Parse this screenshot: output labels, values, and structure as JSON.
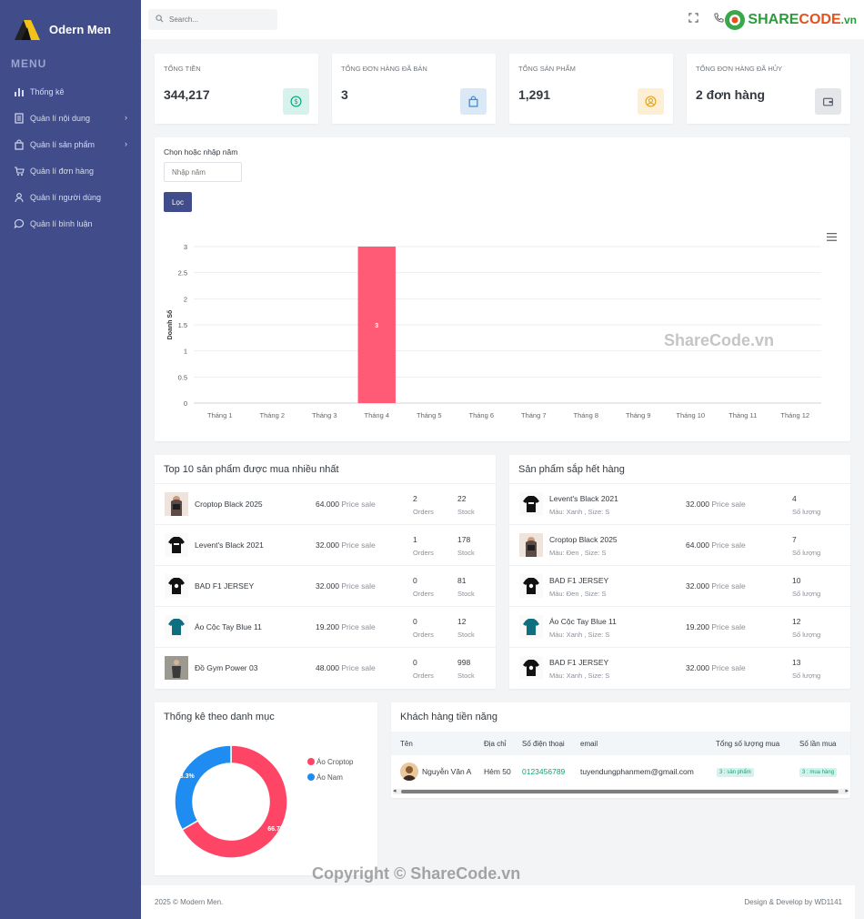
{
  "sidebar": {
    "brand": "Odern Men",
    "menu_title": "MENU",
    "items": [
      {
        "label": "Thống kê",
        "icon": "bar-chart-icon",
        "has_children": false
      },
      {
        "label": "Quản lí nội dung",
        "icon": "document-icon",
        "has_children": true
      },
      {
        "label": "Quản lí sản phẩm",
        "icon": "shopping-bag-icon",
        "has_children": true
      },
      {
        "label": "Quản lí đơn hàng",
        "icon": "cart-icon",
        "has_children": false
      },
      {
        "label": "Quản lí người dùng",
        "icon": "user-icon",
        "has_children": false
      },
      {
        "label": "Quản lí bình luận",
        "icon": "comment-icon",
        "has_children": false
      }
    ]
  },
  "topbar": {
    "search_placeholder": "Search...",
    "brand_part1": "SHARE",
    "brand_part2": "CODE",
    "brand_part3": ".vn"
  },
  "stats": [
    {
      "label": "TỔNG TIỀN",
      "value": "344,217",
      "icon": "dollar-icon",
      "bg": "#d5f3ec",
      "fg": "#0ca678"
    },
    {
      "label": "TỔNG ĐƠN HÀNG ĐÃ BÁN",
      "value": "3",
      "icon": "shopping-bag-icon",
      "bg": "#dbe9f7",
      "fg": "#3b82c4"
    },
    {
      "label": "TỔNG SẢN PHẨM",
      "value": "1,291",
      "icon": "user-circle-icon",
      "bg": "#fcefd4",
      "fg": "#e0a528"
    },
    {
      "label": "TỔNG ĐƠN HÀNG ĐÃ HỦY",
      "value": "2 đơn hàng",
      "icon": "wallet-icon",
      "bg": "#e4e6ea",
      "fg": "#5a6270"
    }
  ],
  "filter": {
    "label": "Chọn hoặc nhập năm",
    "placeholder": "Nhập năm",
    "button": "Lọc"
  },
  "chart_data": {
    "type": "bar",
    "categories": [
      "Tháng 1",
      "Tháng 2",
      "Tháng 3",
      "Tháng 4",
      "Tháng 5",
      "Tháng 6",
      "Tháng 7",
      "Tháng 8",
      "Tháng 9",
      "Tháng 10",
      "Tháng 11",
      "Tháng 12"
    ],
    "values": [
      0,
      0,
      0,
      3,
      0,
      0,
      0,
      0,
      0,
      0,
      0,
      0
    ],
    "ylabel": "Doanh Số",
    "ylim": [
      0,
      3
    ],
    "yticks": [
      "0",
      "0.5",
      "1",
      "1.5",
      "2",
      "2.5",
      "3"
    ],
    "color": "#ff5b77",
    "grid": true
  },
  "top_products": {
    "title": "Top 10 sản phẩm được mua nhiều nhất",
    "items": [
      {
        "name": "Croptop Black 2025",
        "price": "64.000",
        "price_label": "Price sale",
        "orders": "2",
        "orders_label": "Orders",
        "stock": "22",
        "stock_label": "Stock",
        "thumb": "croptop"
      },
      {
        "name": "Levent's Black 2021",
        "price": "32.000",
        "price_label": "Price sale",
        "orders": "1",
        "orders_label": "Orders",
        "stock": "178",
        "stock_label": "Stock",
        "thumb": "black-tee"
      },
      {
        "name": "BAD F1 JERSEY",
        "price": "32.000",
        "price_label": "Price sale",
        "orders": "0",
        "orders_label": "Orders",
        "stock": "81",
        "stock_label": "Stock",
        "thumb": "black-tee-2"
      },
      {
        "name": "Áo Cộc Tay Blue 11",
        "price": "19.200",
        "price_label": "Price sale",
        "orders": "0",
        "orders_label": "Orders",
        "stock": "12",
        "stock_label": "Stock",
        "thumb": "blue-tee"
      },
      {
        "name": "Đồ Gym Power 03",
        "price": "48.000",
        "price_label": "Price sale",
        "orders": "0",
        "orders_label": "Orders",
        "stock": "998",
        "stock_label": "Stock",
        "thumb": "gym"
      }
    ]
  },
  "low_stock": {
    "title": "Sản phẩm sắp hết hàng",
    "items": [
      {
        "name": "Levent's Black 2021",
        "variant": "Màu: Xanh , Size: S",
        "price": "32.000",
        "price_label": "Price sale",
        "qty": "4",
        "qty_label": "Số lượng",
        "thumb": "black-tee"
      },
      {
        "name": "Croptop Black 2025",
        "variant": "Màu: Đen , Size: S",
        "price": "64.000",
        "price_label": "Price sale",
        "qty": "7",
        "qty_label": "Số lượng",
        "thumb": "croptop"
      },
      {
        "name": "BAD F1 JERSEY",
        "variant": "Màu: Đen , Size: S",
        "price": "32.000",
        "price_label": "Price sale",
        "qty": "10",
        "qty_label": "Số lượng",
        "thumb": "black-tee-2"
      },
      {
        "name": "Áo Cộc Tay Blue 11",
        "variant": "Màu: Xanh , Size: S",
        "price": "19.200",
        "price_label": "Price sale",
        "qty": "12",
        "qty_label": "Số lượng",
        "thumb": "blue-tee"
      },
      {
        "name": "BAD F1 JERSEY",
        "variant": "Màu: Xanh , Size: S",
        "price": "32.000",
        "price_label": "Price sale",
        "qty": "13",
        "qty_label": "Số lượng",
        "thumb": "black-tee-2"
      }
    ]
  },
  "category_chart": {
    "title": "Thống kê theo danh mục",
    "chart_data": {
      "type": "pie",
      "labels": [
        "Áo Croptop",
        "Áo Nam"
      ],
      "values": [
        66.7,
        33.3
      ],
      "data_labels": [
        "66.7%",
        "33.3%"
      ],
      "colors": [
        "#ff4565",
        "#1e8cf0"
      ],
      "legend": "right"
    }
  },
  "customers": {
    "title": "Khách hàng tiền năng",
    "columns": [
      "Tên",
      "Địa chỉ",
      "Số điện thoại",
      "email",
      "Tổng số lượng mua",
      "Số lần mua"
    ],
    "rows": [
      {
        "name": "Nguyễn Văn A",
        "address": "Hẻm 50",
        "phone": "0123456789",
        "email": "tuyendungphanmem@gmail.com",
        "total_qty": "3 : sản phẩm",
        "times": "3 : mua hàng"
      }
    ]
  },
  "footer": {
    "left": "2025 © Modern Men.",
    "right": "Design & Develop by WD1141"
  },
  "watermarks": {
    "center": "ShareCode.vn",
    "bottom": "Copyright © ShareCode.vn"
  }
}
